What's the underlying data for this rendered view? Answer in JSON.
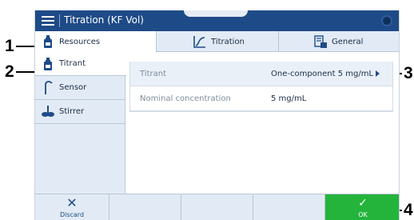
{
  "window": {
    "title": "Titration (KF Vol)"
  },
  "tabs": [
    {
      "label": "Resources",
      "icon": "bottle-icon"
    },
    {
      "label": "Titration",
      "icon": "titration-curve-icon"
    },
    {
      "label": "General",
      "icon": "settings-sheet-icon"
    }
  ],
  "sidebar": {
    "items": [
      {
        "label": "Titrant",
        "icon": "titrant-bottle-icon"
      },
      {
        "label": "Sensor",
        "icon": "sensor-icon"
      },
      {
        "label": "Stirrer",
        "icon": "stirrer-icon"
      }
    ]
  },
  "content": {
    "rows": [
      {
        "label": "Titrant",
        "value": "One-component 5 mg/mL"
      },
      {
        "label": "Nominal concentration",
        "value": "5 mg/mL"
      }
    ]
  },
  "actions": {
    "discard": "Discard",
    "ok": "OK"
  },
  "callouts": [
    "1",
    "2",
    "3",
    "4"
  ],
  "colors": {
    "header": "#1e4b87",
    "ok": "#24b43c",
    "panel": "#e2ebf5"
  }
}
